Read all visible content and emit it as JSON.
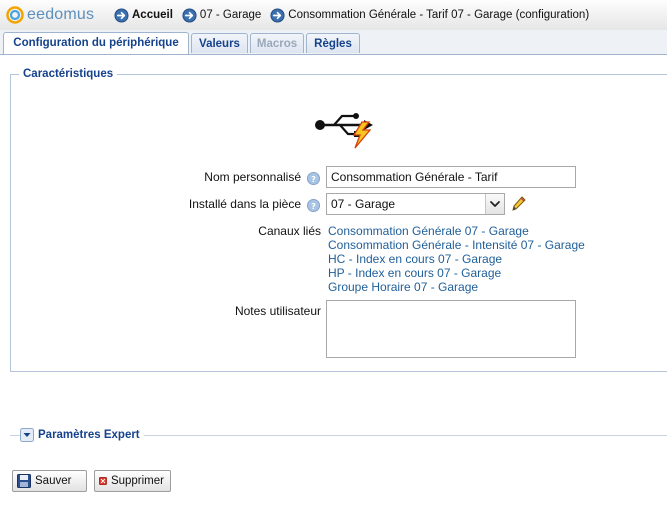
{
  "header": {
    "logo_text": "eedomus",
    "breadcrumbs": [
      {
        "label": "Accueil"
      },
      {
        "label": "07 - Garage"
      },
      {
        "label": "Consommation Générale - Tarif 07 - Garage (configuration)"
      }
    ]
  },
  "tabs": [
    {
      "label": "Configuration du périphérique",
      "state": "active"
    },
    {
      "label": "Valeurs",
      "state": "normal"
    },
    {
      "label": "Macros",
      "state": "disabled"
    },
    {
      "label": "Règles",
      "state": "normal"
    }
  ],
  "section": {
    "legend": "Caractéristiques",
    "device_icon": "usb-lightning-icon"
  },
  "form": {
    "name_label": "Nom personnalisé",
    "name_value": "Consommation Générale - Tarif",
    "room_label": "Installé dans la pièce",
    "room_value": "07 - Garage",
    "channels_label": "Canaux liés",
    "channels": [
      "Consommation Générale 07 - Garage",
      "Consommation Générale - Intensité 07 - Garage",
      "HC - Index en cours 07 - Garage",
      "HP - Index en cours 07 - Garage",
      "Groupe Horaire 07 - Garage"
    ],
    "notes_label": "Notes utilisateur",
    "notes_value": ""
  },
  "expert": {
    "label": "Paramètres Expert"
  },
  "buttons": {
    "save": "Sauver",
    "delete": "Supprimer"
  },
  "colors": {
    "accent": "#15428b",
    "link": "#1f5f99",
    "tab_border": "#9fb4cf"
  }
}
